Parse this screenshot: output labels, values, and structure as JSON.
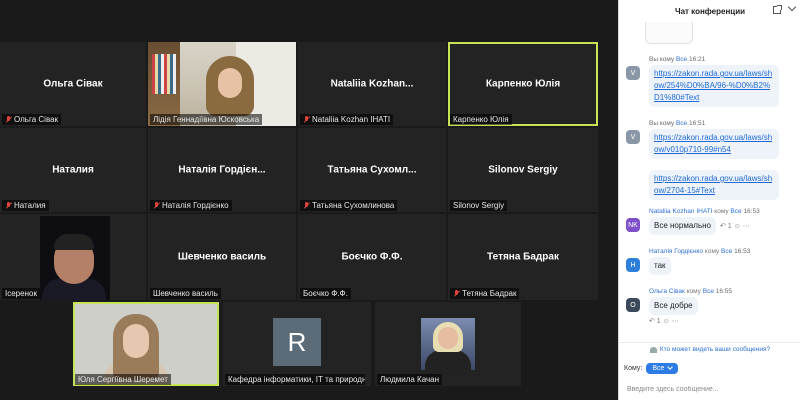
{
  "gallery": {
    "tiles": [
      {
        "name": "Ольга Сівак",
        "label": "Ольга Сівак"
      },
      {
        "name": "",
        "label": "Лідія Геннадіївна Юсковська"
      },
      {
        "name": "Nataliia  Kozhan...",
        "label": "Nataliia Kozhan IHATI"
      },
      {
        "name": "Карпенко Юлія",
        "label": "Карпенко Юлія"
      },
      {
        "name": "Наталия",
        "label": "Наталия"
      },
      {
        "name": "Наталія Гордієн...",
        "label": "Наталія Гордієнко"
      },
      {
        "name": "Татьяна  Сухомл...",
        "label": "Татьяна Сухомлинова"
      },
      {
        "name": "Silonov Sergiy",
        "label": "Silonov Sergiy"
      },
      {
        "name": "",
        "label": "Ісеренок"
      },
      {
        "name": "Шевченко василь",
        "label": "Шевченко василь"
      },
      {
        "name": "Боєчко Ф.Ф.",
        "label": "Боєчко Ф.Ф."
      },
      {
        "name": "Тетяна Бадрак",
        "label": "Тетяна Бадрак"
      },
      {
        "name": "",
        "label": "Юля Сергіївна Шеремет"
      },
      {
        "name": "R",
        "label": "Кафедра інформатики, ІТ та природнич..."
      },
      {
        "name": "",
        "label": "Людмила Качан"
      }
    ]
  },
  "chat": {
    "title": "Чат конференции",
    "visibility_note": "Кто может видеть ваши сообщения?",
    "to_label": "Кому:",
    "to_value": "Все",
    "compose_placeholder": "Введите здесь сообщение...",
    "you_to": "Вы кому",
    "all": "Все",
    "to_word": "кому",
    "messages": [
      {
        "avatar": "V",
        "avatar_color": "#8a97a6",
        "time": "16:21",
        "link": "https://zakon.rada.gov.ua/laws/show/254%D0%BA/96-%D0%B2%D1%80#Text"
      },
      {
        "avatar": "V",
        "avatar_color": "#8a97a6",
        "time": "16:51",
        "link": "https://zakon.rada.gov.ua/laws/show/v010p710-99#n54"
      },
      {
        "link": "https://zakon.rada.gov.ua/laws/show/2704-15#Text"
      },
      {
        "avatar": "NK",
        "avatar_color": "#7e4fc9",
        "sender": "Nataliia Kozhan IHATI",
        "time": "16:53",
        "text": "Все нормально"
      },
      {
        "avatar": "H",
        "avatar_color": "#2e7fd9",
        "sender": "Наталія Гордієнко",
        "time": "16:53",
        "text": "так"
      },
      {
        "avatar": "O",
        "avatar_color": "#3a4a5a",
        "sender": "Ольга Сівак",
        "time": "16:55",
        "text": "Все добре"
      }
    ]
  }
}
